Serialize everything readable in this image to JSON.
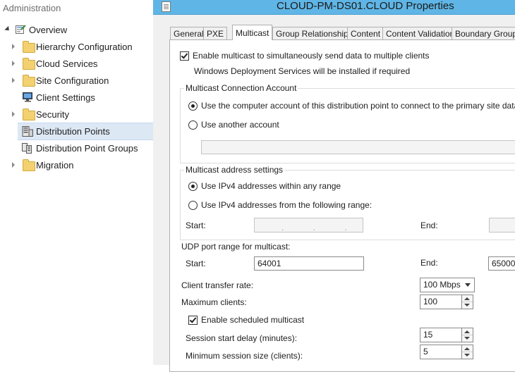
{
  "nav": {
    "title": "Administration",
    "items": [
      {
        "label": "Overview"
      },
      {
        "label": "Hierarchy Configuration"
      },
      {
        "label": "Cloud Services"
      },
      {
        "label": "Site Configuration"
      },
      {
        "label": "Client Settings"
      },
      {
        "label": "Security"
      },
      {
        "label": "Distribution Points"
      },
      {
        "label": "Distribution Point Groups"
      },
      {
        "label": "Migration"
      }
    ]
  },
  "dialog": {
    "title": "CLOUD-PM-DS01.CLOUD Properties",
    "tabs": [
      {
        "label": "General"
      },
      {
        "label": "PXE"
      },
      {
        "label": "Multicast"
      },
      {
        "label": "Group Relationships"
      },
      {
        "label": "Content"
      },
      {
        "label": "Content Validation"
      },
      {
        "label": "Boundary Groups"
      }
    ],
    "active_tab": "Multicast",
    "multicast": {
      "enable_label": "Enable multicast to simultaneously send data to multiple clients",
      "enable_checked": true,
      "wds_note": "Windows Deployment Services will be installed if required",
      "connection_account": {
        "title": "Multicast Connection Account",
        "option_computer": "Use the computer account of this distribution point to connect to the primary site database",
        "option_another": "Use another account",
        "account_value": ""
      },
      "address_settings": {
        "title": "Multicast address settings",
        "option_any": "Use IPv4 addresses within any range",
        "option_range": "Use IPv4 addresses from the following range:",
        "start_label": "Start:",
        "start_value": ". . .",
        "end_label": "End:",
        "end_value": ""
      },
      "udp": {
        "title": "UDP port range for multicast:",
        "start_label": "Start:",
        "start_value": "64001",
        "end_label": "End:",
        "end_value": "65000"
      },
      "transfer_rate": {
        "label": "Client transfer rate:",
        "value": "100 Mbps"
      },
      "max_clients": {
        "label": "Maximum clients:",
        "value": "100"
      },
      "scheduled": {
        "label": "Enable scheduled multicast",
        "checked": true,
        "start_delay_label": "Session start delay (minutes):",
        "start_delay_value": "15",
        "min_size_label": "Minimum session size (clients):",
        "min_size_value": "5"
      }
    }
  }
}
